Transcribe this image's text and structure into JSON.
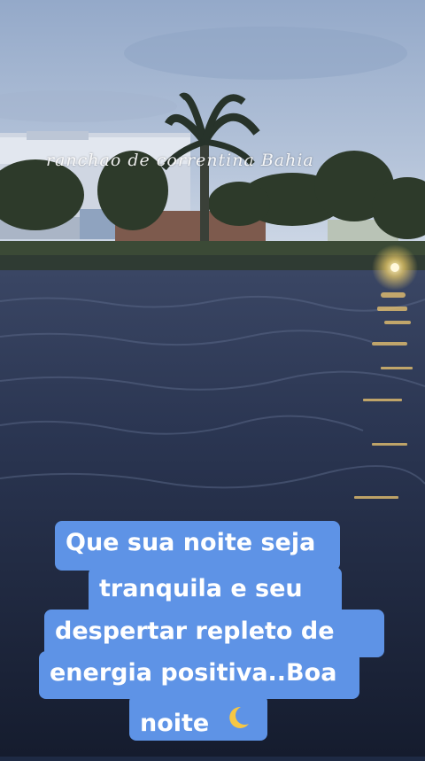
{
  "photo": {
    "subject": "river at dusk with palm tree, buildings and a light on the far bank",
    "colors": {
      "sky_top": "#9fb2cf",
      "sky_bottom": "#c9d4e4",
      "water": "#28324c",
      "caption_bg": "#5e93e6"
    }
  },
  "watermark": "ranchao de correntina Bahia",
  "caption": {
    "line1": "Que  sua noite  seja",
    "line2": "tranquila e seu",
    "line3": "despertar repleto de",
    "line4": "energia  positiva..Boa",
    "line5": "noite",
    "moon_icon": "crescent-moon-icon"
  }
}
